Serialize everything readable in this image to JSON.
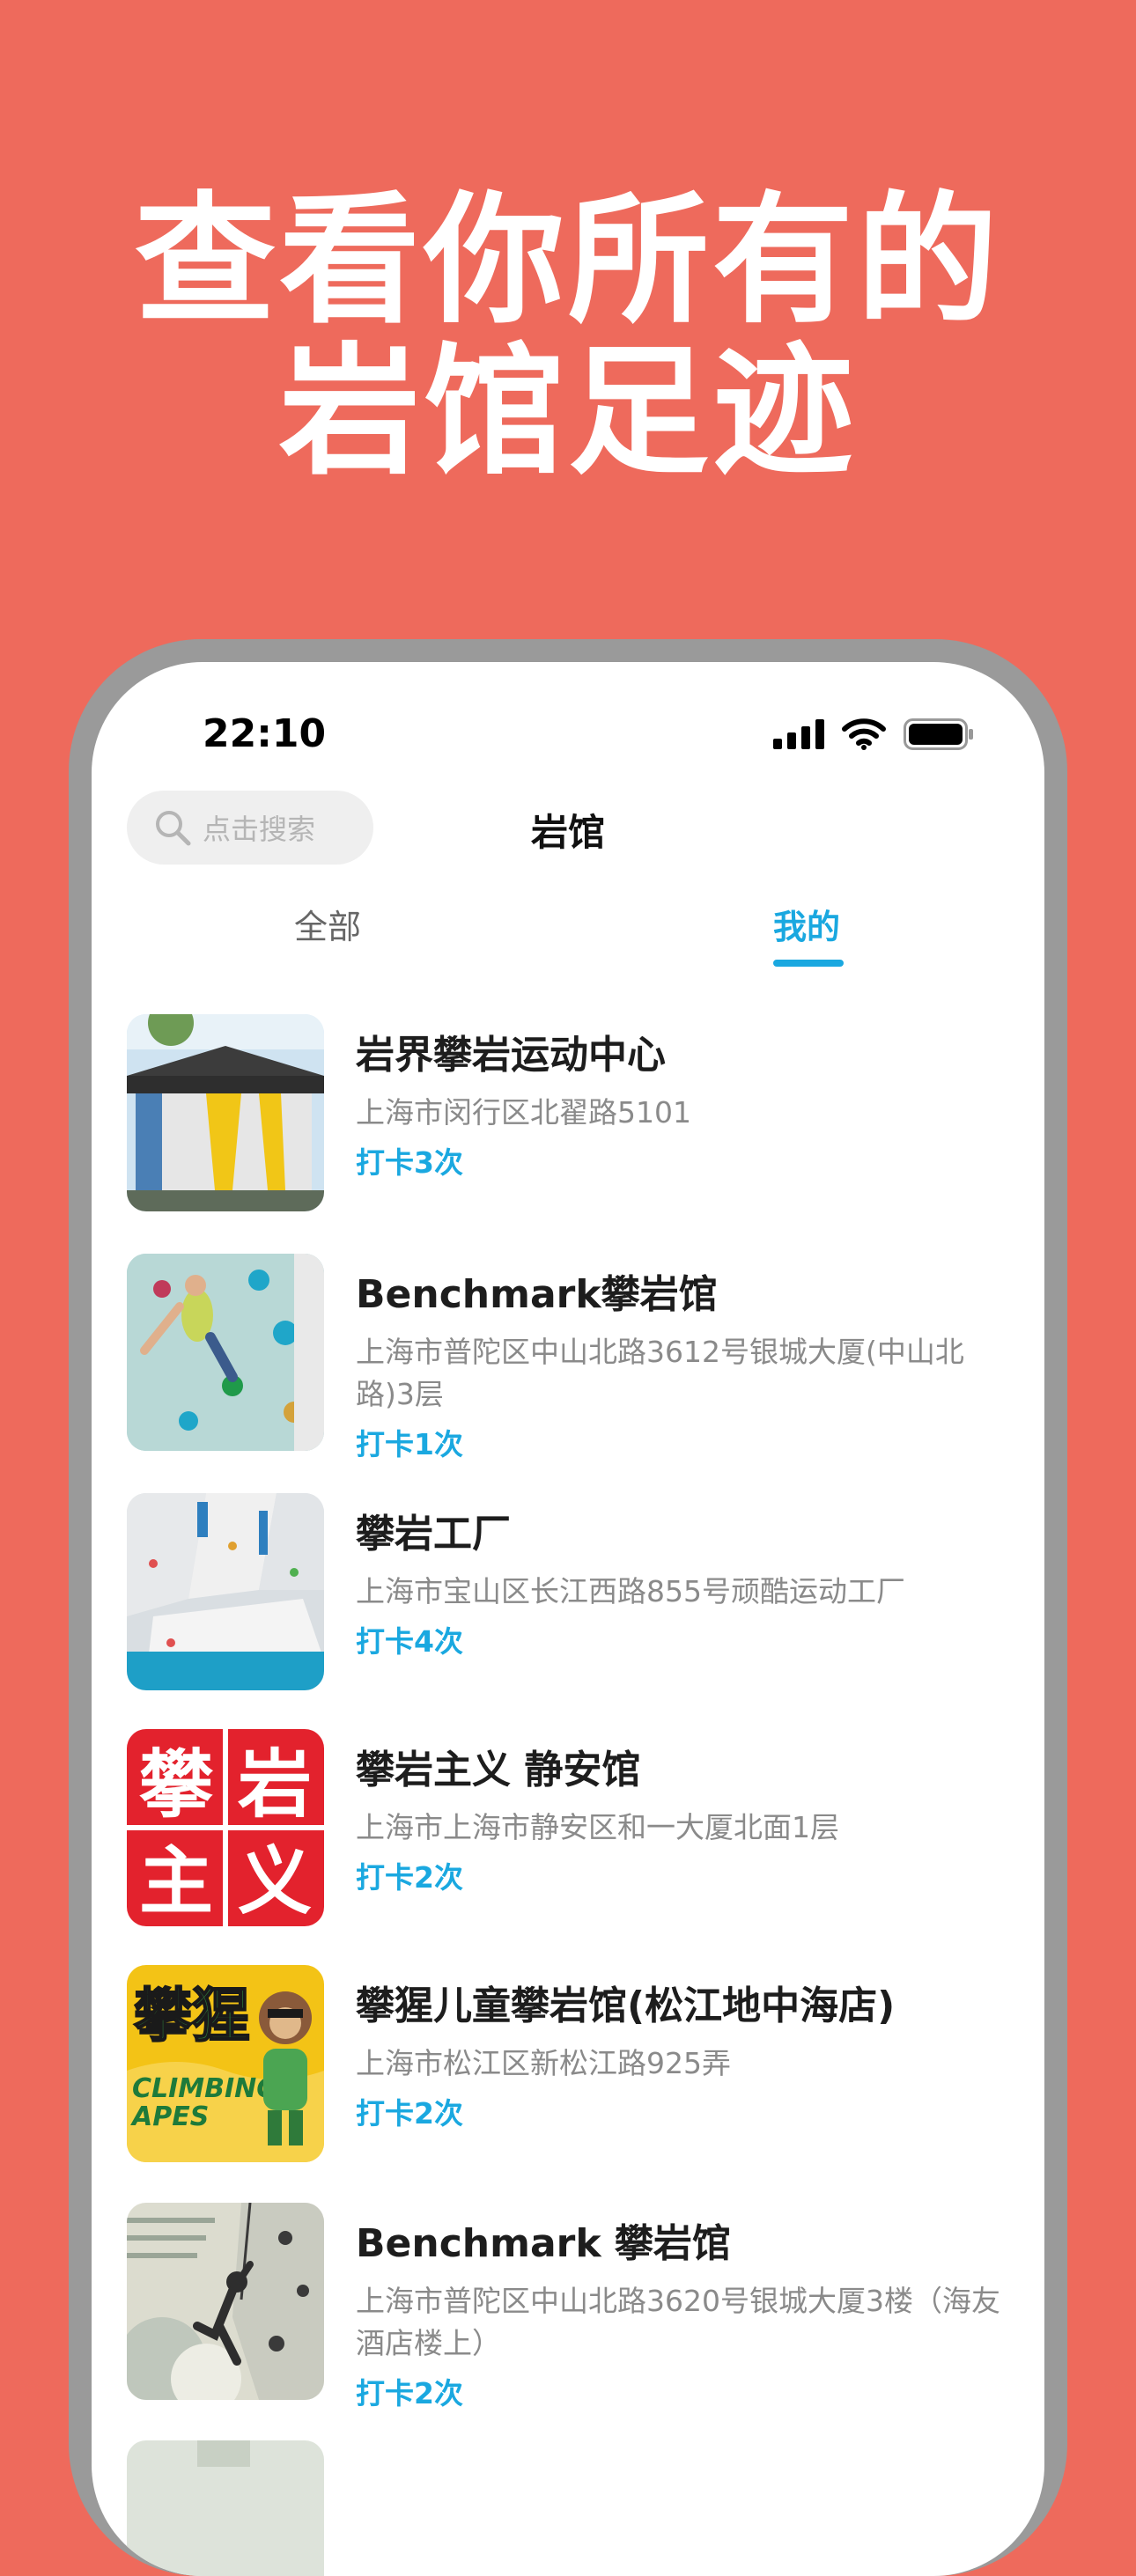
{
  "headline": {
    "line1": "查看你所有的",
    "line2": "岩馆足迹"
  },
  "status_bar": {
    "time": "22:10"
  },
  "nav": {
    "search_placeholder": "点击搜索",
    "title": "岩馆"
  },
  "tabs": [
    {
      "label": "全部",
      "active": false
    },
    {
      "label": "我的",
      "active": true
    }
  ],
  "gyms": [
    {
      "name": "岩界攀岩运动中心",
      "address": "上海市闵行区北翟路5101",
      "checkins": "打卡3次"
    },
    {
      "name": "Benchmark攀岩馆",
      "address": "上海市普陀区中山北路3612号银城大厦(中山北路)3层",
      "checkins": "打卡1次"
    },
    {
      "name": "攀岩工厂",
      "address": "上海市宝山区长江西路855号顽酷运动工厂",
      "checkins": "打卡4次"
    },
    {
      "name": "攀岩主义 静安馆",
      "address": "上海市上海市静安区和一大厦北面1层",
      "checkins": "打卡2次"
    },
    {
      "name": "攀猩儿童攀岩馆(松江地中海店)",
      "address": "上海市松江区新松江路925弄",
      "checkins": "打卡2次"
    },
    {
      "name": "Benchmark 攀岩馆",
      "address": "上海市普陀区中山北路3620号银城大厦3楼（海友酒店楼上）",
      "checkins": "打卡2次"
    }
  ],
  "logos": {
    "panyan_zhuyi": [
      "攀",
      "岩",
      "主",
      "义"
    ],
    "climbing_apes": {
      "chinese": "攀猩",
      "english_line1": "CLIMBING",
      "english_line2": "APES"
    }
  },
  "colors": {
    "background": "#EE6A5C",
    "accent": "#1AA8E0",
    "phone_frame": "#9A9A9A"
  }
}
